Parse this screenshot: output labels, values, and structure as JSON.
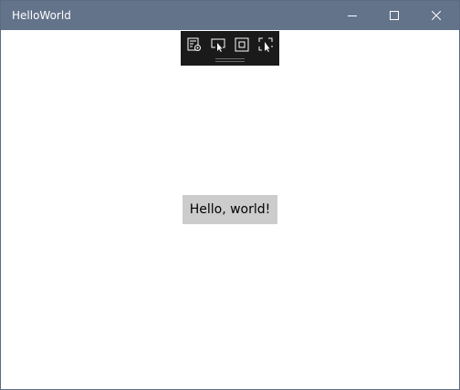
{
  "window": {
    "title": "HelloWorld"
  },
  "caption_buttons": {
    "minimize_icon": "minimize-icon",
    "maximize_icon": "maximize-icon",
    "close_icon": "close-icon"
  },
  "debug_toolbar": {
    "tools": [
      {
        "icon": "live-visual-tree-icon"
      },
      {
        "icon": "select-element-icon"
      },
      {
        "icon": "display-layout-adorners-icon"
      },
      {
        "icon": "track-focus-icon"
      }
    ]
  },
  "main": {
    "hello_button_label": "Hello, world!"
  },
  "colors": {
    "titlebar": "#63738a",
    "toolbar": "#1a1a1a",
    "button_bg": "#cccccc",
    "window_bg": "#ffffff"
  }
}
